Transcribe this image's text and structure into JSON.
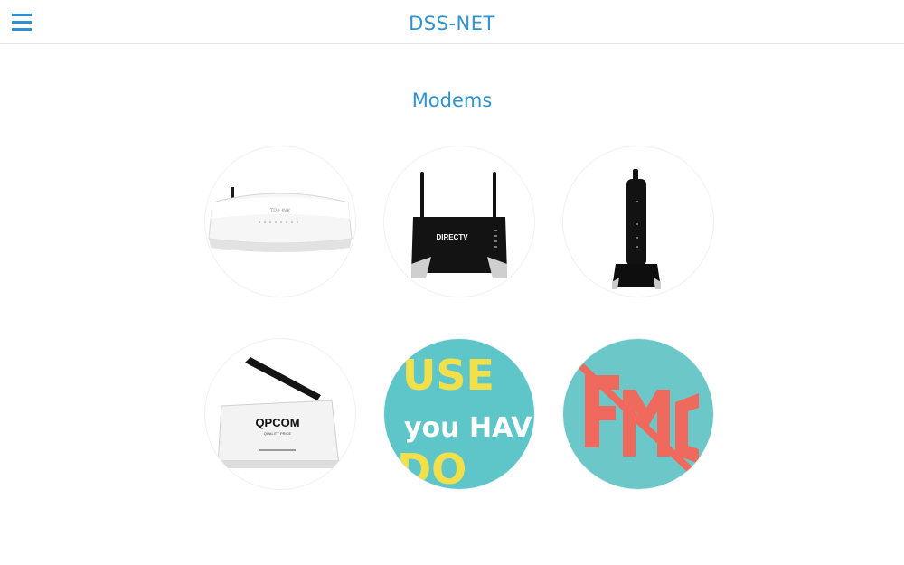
{
  "header": {
    "brand": "DSS-NET",
    "menu_icon": "hamburger-menu-icon",
    "accent_color": "#2f93d0"
  },
  "page": {
    "title": "Modems"
  },
  "products": [
    {
      "name": "tp-link-router",
      "logo_text": "TP-LINK"
    },
    {
      "name": "directv-modem",
      "logo_text": "DIRECTV"
    },
    {
      "name": "vertical-modem",
      "logo_text": ""
    },
    {
      "name": "qpcom-router",
      "logo_text": "QPCOM",
      "sub_text": "QUALITY PRICE"
    },
    {
      "name": "lettering-art-1",
      "art_text": [
        "USE",
        "you HAV",
        "DO"
      ]
    },
    {
      "name": "lettering-art-2",
      "art_text": []
    }
  ]
}
